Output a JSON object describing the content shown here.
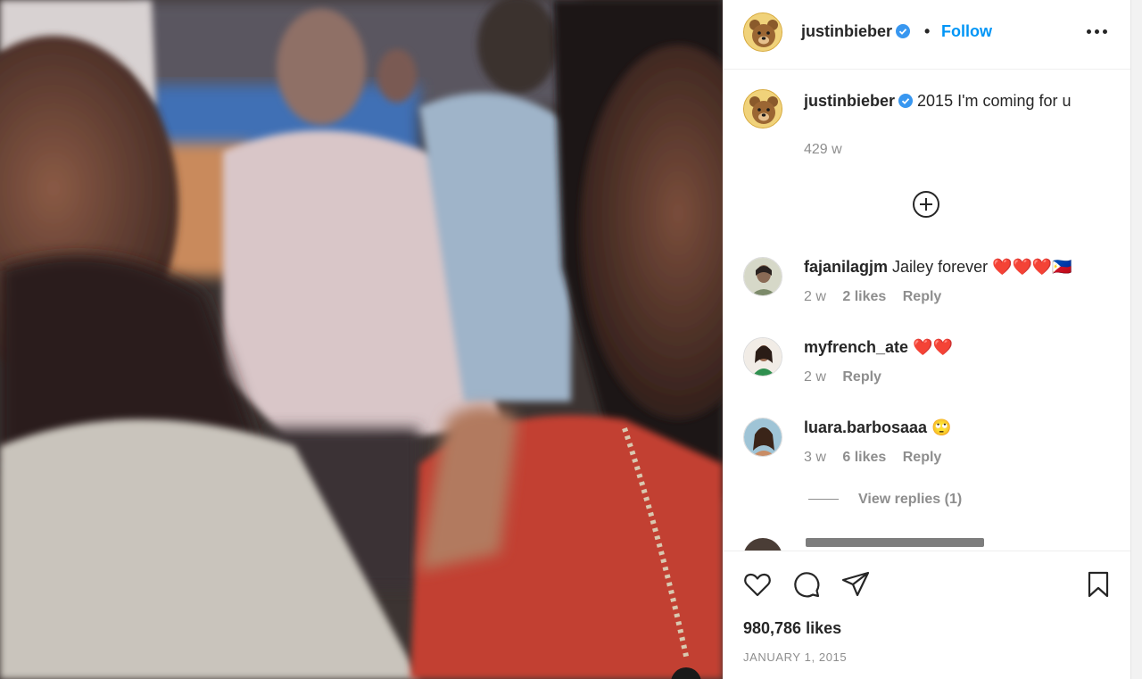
{
  "post": {
    "author": "justinbieber",
    "follow_label": "Follow",
    "separator": "•",
    "more_icon": "more-horizontal-icon",
    "caption": "2015 I'm coming for u",
    "caption_time": "429 w",
    "likes": "980,786 likes",
    "date": "JANUARY 1, 2015",
    "colors": {
      "accent": "#0095f6",
      "muted": "#8e8e8e",
      "text": "#262626",
      "heart": "#e0245e"
    }
  },
  "comments": [
    {
      "username": "fajanilagjm",
      "text": "Jailey forever ❤️❤️❤️🇵🇭",
      "time": "2 w",
      "likes": "2 likes",
      "reply": "Reply"
    },
    {
      "username": "myfrench_ate",
      "text": "❤️❤️",
      "time": "2 w",
      "likes": "",
      "reply": "Reply"
    },
    {
      "username": "luara.barbosaaa",
      "text": "🙄",
      "time": "3 w",
      "likes": "6 likes",
      "reply": "Reply"
    }
  ],
  "view_replies": "View replies (1)",
  "icons": [
    "add-comment-icon",
    "heart-icon",
    "comment-icon",
    "share-icon",
    "bookmark-icon",
    "verified-badge-icon"
  ]
}
